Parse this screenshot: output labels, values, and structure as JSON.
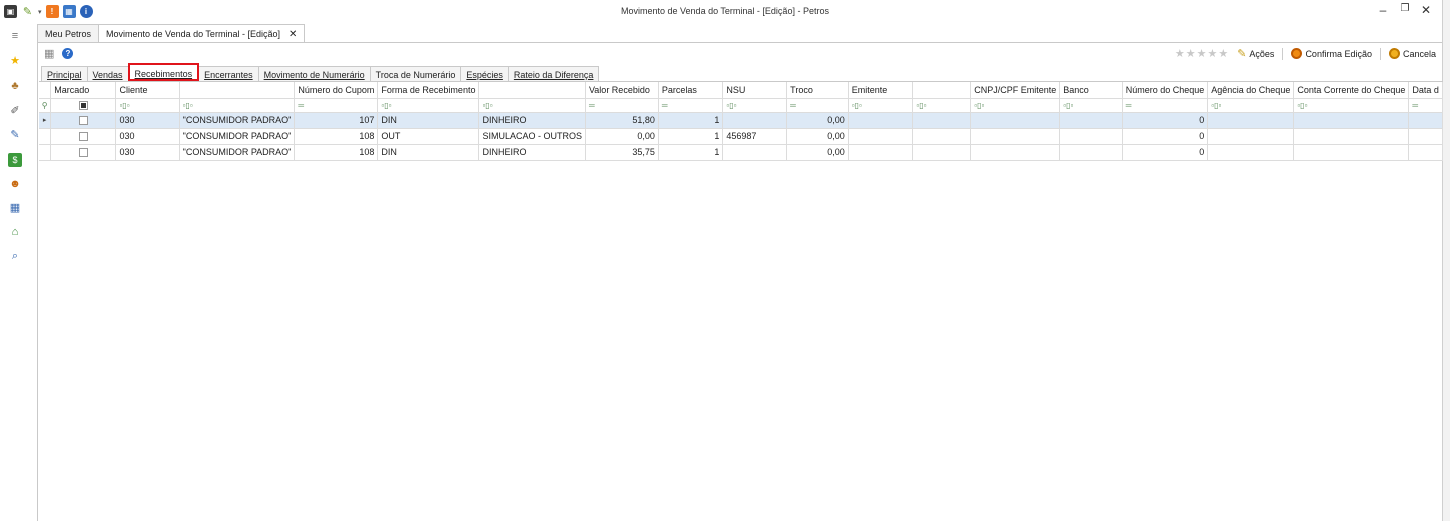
{
  "window": {
    "title": "Movimento de Venda do Terminal - [Edição] - Petros"
  },
  "doc_tabs": [
    {
      "label": "Meu Petros",
      "active": false
    },
    {
      "label": "Movimento de Venda do Terminal - [Edição]",
      "active": true
    }
  ],
  "toolbar": {
    "acoes": "Ações",
    "confirma": "Confirma Edição",
    "cancela": "Cancela",
    "stars": "★★★★★"
  },
  "sub_tabs": {
    "principal": "Principal",
    "vendas": "Vendas",
    "recebimentos": "Recebimentos",
    "encerrantes": "Encerrantes",
    "movimento_numerario": "Movimento de Numerário",
    "troca_numerario": "Troca de Numerário",
    "especies": "Espécies",
    "rateio": "Rateio da Diferença"
  },
  "grid": {
    "columns": [
      "Marcado",
      "Cliente",
      "",
      "Número do Cupom",
      "Forma de Recebimento",
      "",
      "Valor Recebido",
      "Parcelas",
      "NSU",
      "Troco",
      "Emitente",
      "",
      "CNPJ/CPF Emitente",
      "Banco",
      "Número do Cheque",
      "Agência do Cheque",
      "Conta Corrente do Cheque",
      "Data d"
    ],
    "filter_row": [
      "",
      "▫▯▫",
      "▫▯▫",
      "═",
      "▫▯▫",
      "▫▯▫",
      "═",
      "═",
      "▫▯▫",
      "═",
      "▫▯▫",
      "▫▯▫",
      "▫▯▫",
      "▫▯▫",
      "═",
      "▫▯▫",
      "▫▯▫",
      "═"
    ],
    "rows": [
      {
        "cliente": "030",
        "nome": "\"CONSUMIDOR PADRAO\"",
        "cupom": "107",
        "forma": "DIN",
        "desc": "DINHEIRO",
        "valor": "51,80",
        "parcelas": "1",
        "nsu": "",
        "troco": "0,00",
        "cheque": "0"
      },
      {
        "cliente": "030",
        "nome": "\"CONSUMIDOR PADRAO\"",
        "cupom": "108",
        "forma": "OUT",
        "desc": "SIMULACAO - OUTROS",
        "valor": "0,00",
        "parcelas": "1",
        "nsu": "456987",
        "troco": "0,00",
        "cheque": "0"
      },
      {
        "cliente": "030",
        "nome": "\"CONSUMIDOR PADRAO\"",
        "cupom": "108",
        "forma": "DIN",
        "desc": "DINHEIRO",
        "valor": "35,75",
        "parcelas": "1",
        "nsu": "",
        "troco": "0,00",
        "cheque": "0"
      }
    ]
  },
  "colors": {
    "selected_row": "#dde9f6",
    "active_tab_border": "#e0141b"
  }
}
